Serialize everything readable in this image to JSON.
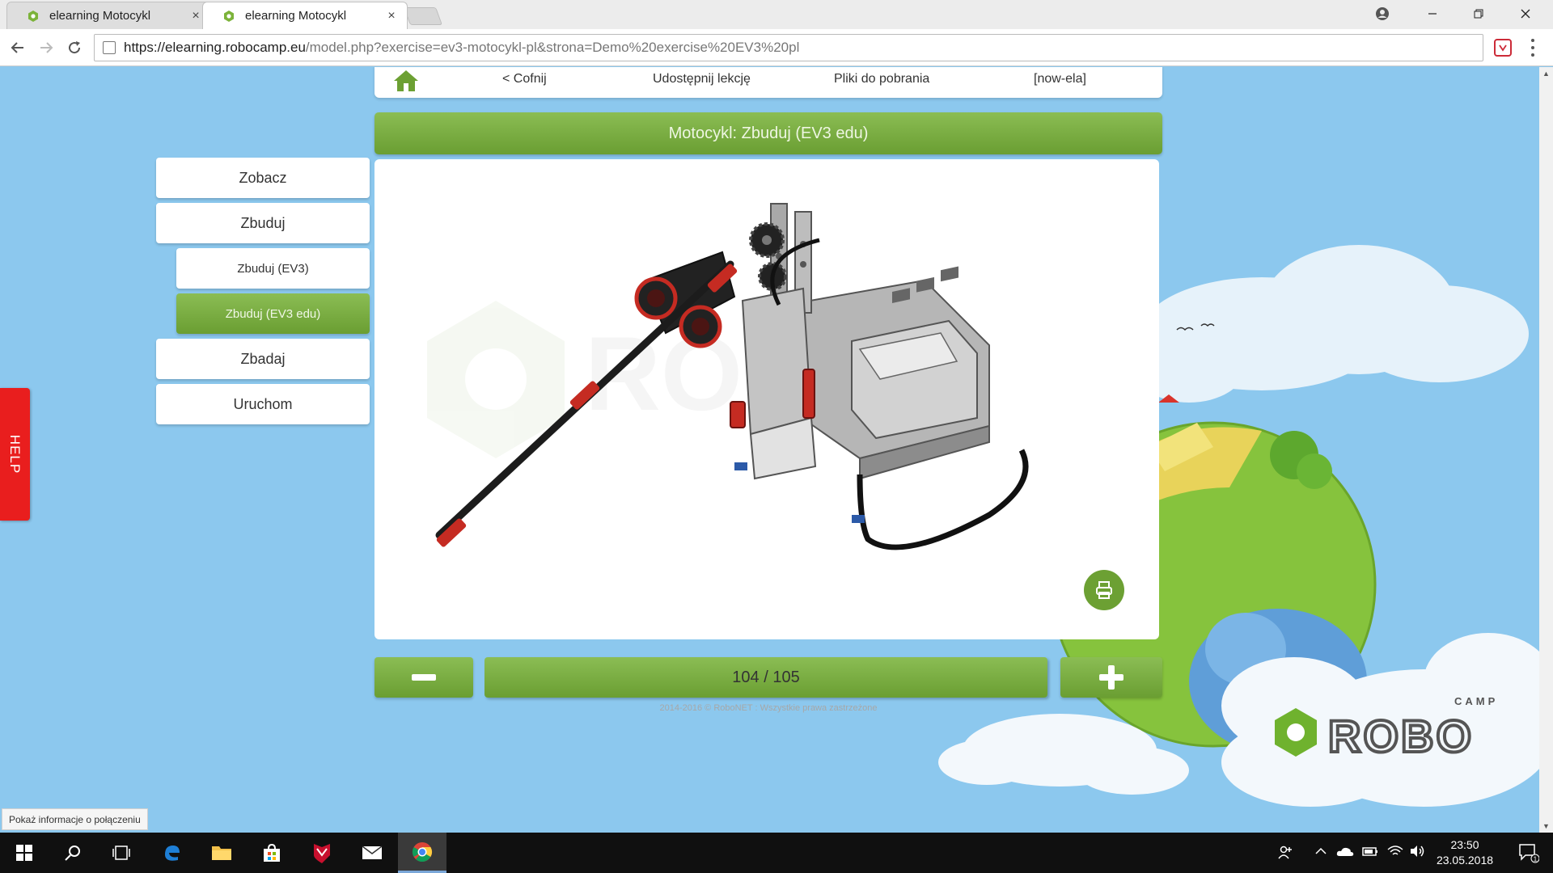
{
  "browser": {
    "tabs": [
      {
        "title": "elearning Motocykl",
        "close": "×",
        "active": false
      },
      {
        "title": "elearning Motocykl",
        "close": "×",
        "active": true
      }
    ],
    "url_host": "https://elearning.robocamp.eu",
    "url_path": "/model.php?exercise=ev3-motocykl-pl&strona=Demo%20exercise%20EV3%20pl",
    "status_tooltip": "Pokaż informacje o połączeniu"
  },
  "nav": {
    "back": "< Cofnij",
    "share": "Udostępnij lekcję",
    "downloads": "Pliki do pobrania",
    "user": "[now-ela]"
  },
  "lesson_title": "Motocykl: Zbuduj (EV3 edu)",
  "sidebar": {
    "items": [
      {
        "label": "Zobacz"
      },
      {
        "label": "Zbuduj"
      },
      {
        "label": "Zbuduj (EV3)"
      },
      {
        "label": "Zbuduj (EV3 edu)",
        "active": true
      },
      {
        "label": "Zbadaj"
      },
      {
        "label": "Uruchom"
      }
    ]
  },
  "help_label": "HELP",
  "pager": {
    "current": 104,
    "total": 105,
    "display": "104 / 105"
  },
  "footer": "2014-2016 © RoboNET : Wszystkie prawa zastrzeżone",
  "logo": {
    "camp": "CAMP",
    "robo": "ROBO"
  },
  "watermark_text": "ROBO",
  "taskbar": {
    "time": "23:50",
    "date": "23.05.2018",
    "notifications": "1"
  },
  "colors": {
    "accent_green": "#7aae3f",
    "help_red": "#e91e1e",
    "sky": "#8cc8ee"
  }
}
